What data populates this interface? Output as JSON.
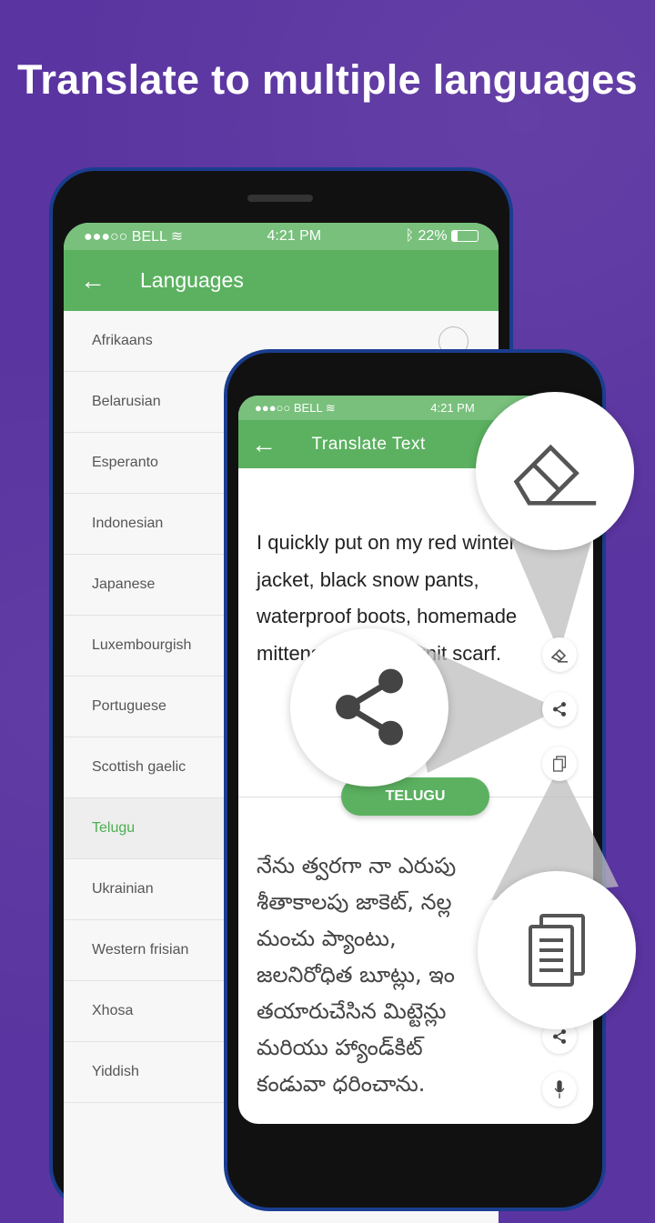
{
  "headline": "Translate to multiple languages",
  "status": {
    "carrier": "●●●○○ BELL",
    "time": "4:21 PM",
    "battery": "22%"
  },
  "languages_screen": {
    "title": "Languages",
    "items": [
      "Afrikaans",
      "Belarusian",
      "Esperanto",
      "Indonesian",
      "Japanese",
      "Luxembourgish",
      "Portuguese",
      "Scottish gaelic",
      "Telugu",
      "Ukrainian",
      "Western frisian",
      "Xhosa",
      "Yiddish"
    ],
    "selected": "Telugu"
  },
  "translate_screen": {
    "title": "Translate Text",
    "source_lines": [
      "I quickly put on my red winter",
      "jacket, black snow pants,",
      "waterproof boots, homemade",
      "mittens, and handknit scarf."
    ],
    "target_language": "TELUGU",
    "translated_lines": [
      "నేను త్వరగా నా ఎరుపు",
      "శీతాకాలపు జాకెట్, నల్ల",
      "మంచు ప్యాంటు,",
      "జలనిరోధిత బూట్లు, ఇం",
      "తయారుచేసిన మిట్టెన్లు",
      "మరియు హ్యాండ్‌కిట్",
      "కండువా ధరించాను."
    ]
  },
  "colors": {
    "background": "#5a34a0",
    "green": "#5bb160",
    "selected": "#4caf50"
  },
  "icons": [
    "back-arrow-icon",
    "wifi-icon",
    "bluetooth-icon",
    "battery-icon",
    "eraser-icon",
    "share-icon",
    "copy-icon",
    "microphone-icon"
  ]
}
